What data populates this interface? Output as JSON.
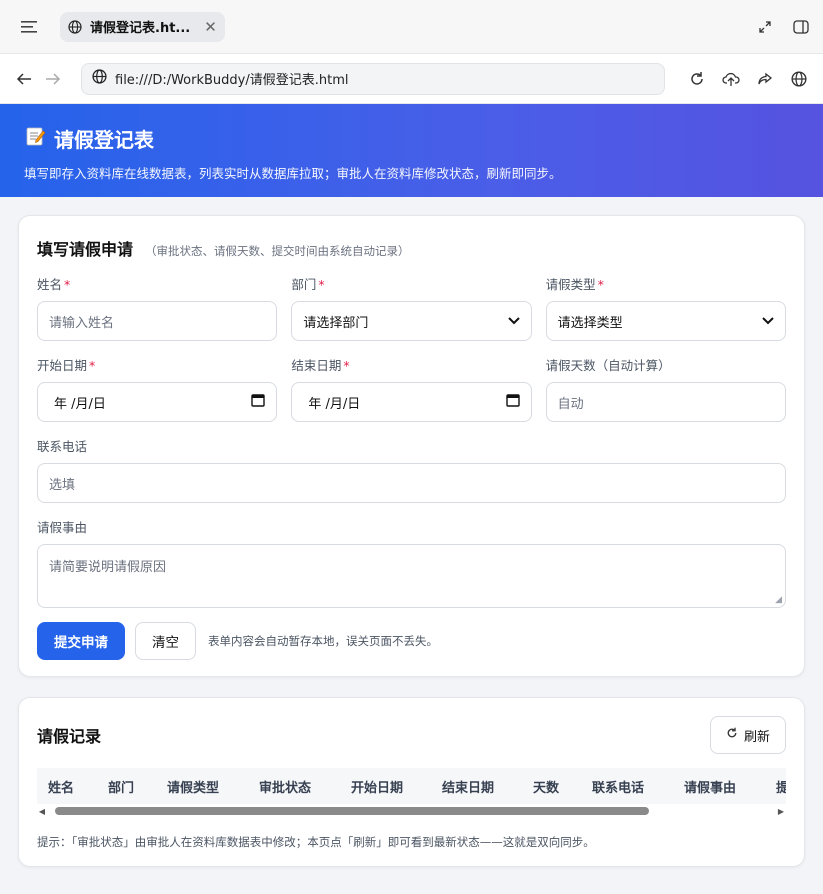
{
  "browser": {
    "tab_title": "请假登记表.ht...",
    "url": "file:///D:/WorkBuddy/请假登记表.html"
  },
  "hero": {
    "icon": "memo-emoji",
    "title": "请假登记表",
    "subtitle": "填写即存入资料库在线数据表，列表实时从数据库拉取；审批人在资料库修改状态，刷新即同步。"
  },
  "form": {
    "title": "填写请假申请",
    "note": "（审批状态、请假天数、提交时间由系统自动记录）",
    "name": {
      "label": "姓名",
      "placeholder": "请输入姓名"
    },
    "department": {
      "label": "部门",
      "value": "请选择部门"
    },
    "leave_type": {
      "label": "请假类型",
      "value": "请选择类型"
    },
    "start_date": {
      "label": "开始日期",
      "value": "年 /月/日"
    },
    "end_date": {
      "label": "结束日期",
      "value": "年 /月/日"
    },
    "days": {
      "label": "请假天数（自动计算）",
      "placeholder": "自动"
    },
    "phone": {
      "label": "联系电话",
      "placeholder": "选填"
    },
    "reason": {
      "label": "请假事由",
      "placeholder": "请简要说明请假原因"
    },
    "required_mark": "*",
    "submit_label": "提交申请",
    "clear_label": "清空",
    "hint": "表单内容会自动暂存本地，误关页面不丢失。"
  },
  "records": {
    "title": "请假记录",
    "refresh_label": "刷新",
    "columns": [
      "姓名",
      "部门",
      "请假类型",
      "审批状态",
      "开始日期",
      "结束日期",
      "天数",
      "联系电话",
      "请假事由",
      "提"
    ],
    "footnote": "提示：「审批状态」由审批人在资料库数据表中修改；本页点「刷新」即可看到最新状态——这就是双向同步。"
  },
  "colors": {
    "accent": "#2563eb",
    "hero_gradient_end": "#5553e0",
    "required": "#e11d48"
  }
}
